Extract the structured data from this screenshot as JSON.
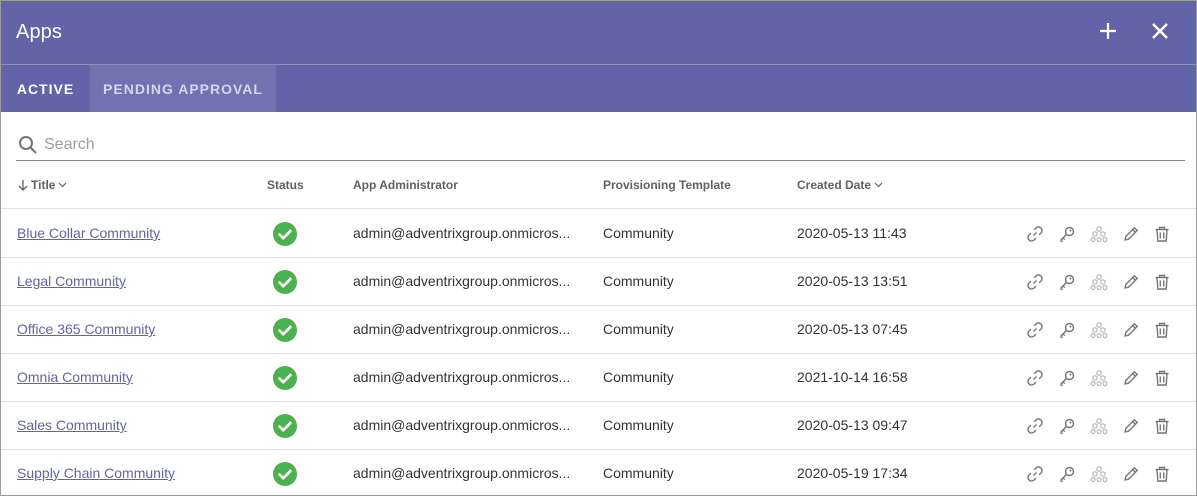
{
  "header": {
    "title": "Apps",
    "add_icon": "plus-icon",
    "close_icon": "close-icon"
  },
  "tabs": [
    {
      "label": "ACTIVE",
      "active": true
    },
    {
      "label": "PENDING APPROVAL",
      "active": false
    }
  ],
  "search": {
    "placeholder": "Search",
    "value": ""
  },
  "table": {
    "columns": {
      "title": "Title",
      "status": "Status",
      "admin": "App Administrator",
      "template": "Provisioning Template",
      "created": "Created Date"
    },
    "rows": [
      {
        "title": "Blue Collar Community",
        "status": "ok",
        "admin": "admin@adventrixgroup.onmicros...",
        "template": "Community",
        "created": "2020-05-13 11:43"
      },
      {
        "title": "Legal Community",
        "status": "ok",
        "admin": "admin@adventrixgroup.onmicros...",
        "template": "Community",
        "created": "2020-05-13 13:51"
      },
      {
        "title": "Office 365 Community",
        "status": "ok",
        "admin": "admin@adventrixgroup.onmicros...",
        "template": "Community",
        "created": "2020-05-13 07:45"
      },
      {
        "title": "Omnia Community",
        "status": "ok",
        "admin": "admin@adventrixgroup.onmicros...",
        "template": "Community",
        "created": "2021-10-14 16:58"
      },
      {
        "title": "Sales Community",
        "status": "ok",
        "admin": "admin@adventrixgroup.onmicros...",
        "template": "Community",
        "created": "2020-05-13 09:47"
      },
      {
        "title": "Supply Chain Community",
        "status": "ok",
        "admin": "admin@adventrixgroup.onmicros...",
        "template": "Community",
        "created": "2020-05-19 17:34"
      }
    ]
  },
  "colors": {
    "brand": "#6264a7",
    "status_ok": "#4caf50",
    "action_icon": "#757575",
    "action_icon_disabled": "#bdbdbd"
  }
}
